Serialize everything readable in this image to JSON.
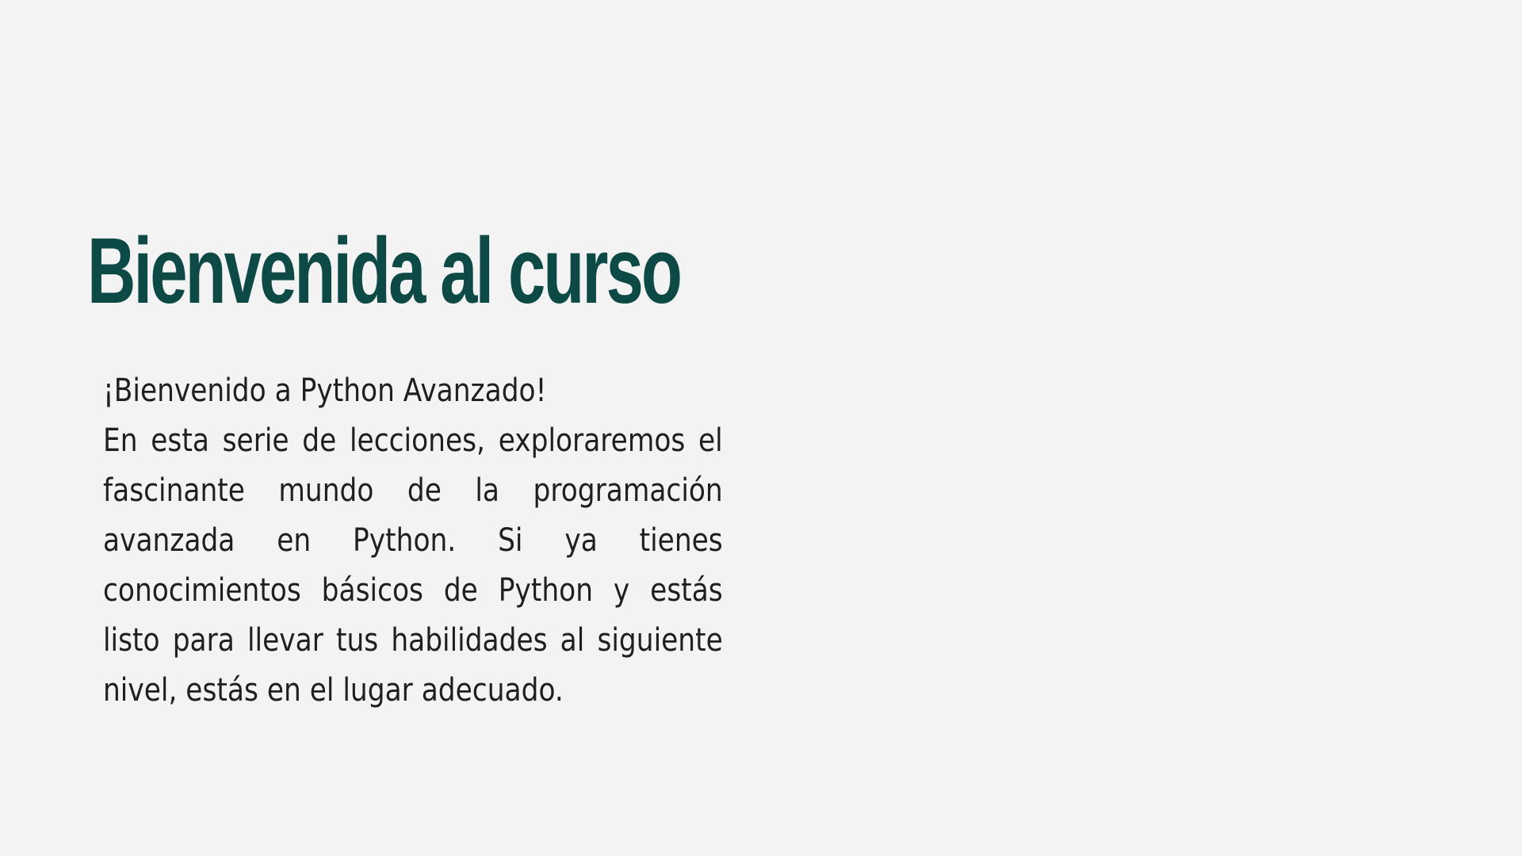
{
  "slide": {
    "title": "Bienvenida al curso",
    "greeting": "¡Bienvenido a Python Avanzado!",
    "paragraph": "En esta serie de lecciones, exploraremos el fascinante mundo de la programación avanzada en Python. Si ya tienes conocimientos básicos de Python y estás listo para llevar tus habilidades al siguiente nivel, estás en el lugar adecuado."
  },
  "colors": {
    "background": "#f3f3f3",
    "title": "#0e4a45",
    "text": "#1f1f1f"
  }
}
